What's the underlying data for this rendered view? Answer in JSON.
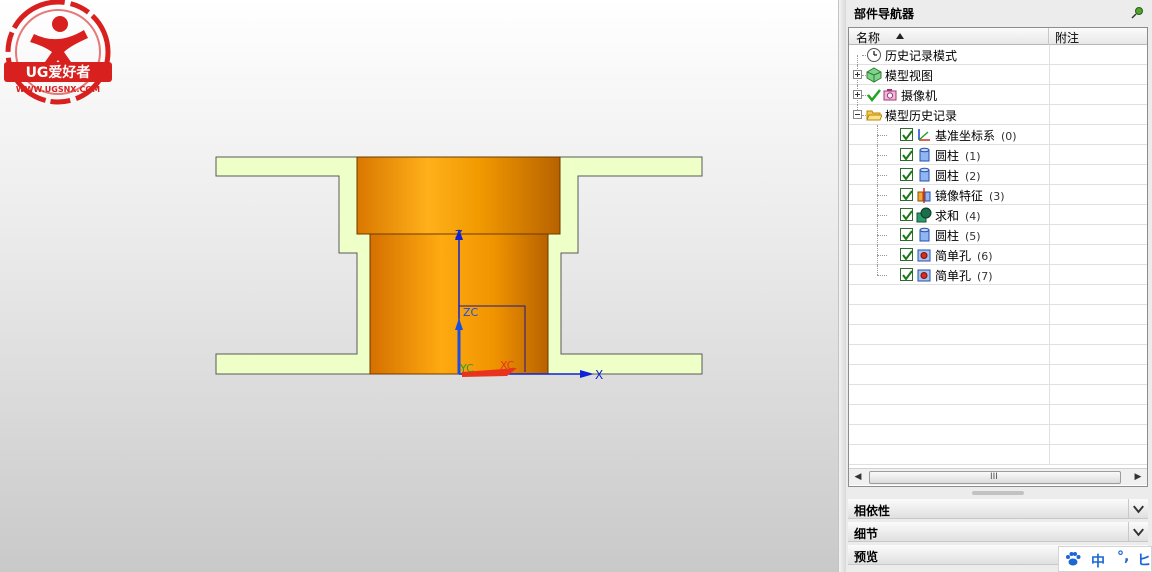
{
  "viewport": {
    "axes": {
      "x": "X",
      "z": "Z",
      "xc": "XC",
      "yc": "YC",
      "zc": "ZC"
    },
    "colors": {
      "part": "#f29a00",
      "fixture": "#eeffc7",
      "axis": "#0f22d6",
      "csys_box": "#1a1a8c"
    }
  },
  "watermark": {
    "brand": "UG爱好者",
    "site": "WWW.UGSNX.COM"
  },
  "navigator": {
    "title": "部件导航器",
    "columns": {
      "name": "名称",
      "note": "附注"
    },
    "rows": [
      {
        "label": "历史记录模式",
        "icon": "clock-icon",
        "level": 0,
        "expander": "none",
        "checked": false,
        "count": ""
      },
      {
        "label": "模型视图",
        "icon": "model-views-icon",
        "level": 0,
        "expander": "plus",
        "checked": false,
        "count": ""
      },
      {
        "label": "摄像机",
        "icon": "camera-icon",
        "level": 0,
        "expander": "plus",
        "checked": true,
        "count": ""
      },
      {
        "label": "模型历史记录",
        "icon": "folder-open-icon",
        "level": 0,
        "expander": "minus",
        "checked": false,
        "count": ""
      },
      {
        "label": "基准坐标系",
        "icon": "datum-csys-icon",
        "level": 1,
        "expander": "none",
        "checked": true,
        "count": "(0)"
      },
      {
        "label": "圆柱",
        "icon": "cylinder-icon",
        "level": 1,
        "expander": "none",
        "checked": true,
        "count": "(1)"
      },
      {
        "label": "圆柱",
        "icon": "cylinder-icon",
        "level": 1,
        "expander": "none",
        "checked": true,
        "count": "(2)"
      },
      {
        "label": "镜像特征",
        "icon": "mirror-feature-icon",
        "level": 1,
        "expander": "none",
        "checked": true,
        "count": "(3)"
      },
      {
        "label": "求和",
        "icon": "unite-icon",
        "level": 1,
        "expander": "none",
        "checked": true,
        "count": "(4)"
      },
      {
        "label": "圆柱",
        "icon": "cylinder-icon",
        "level": 1,
        "expander": "none",
        "checked": true,
        "count": "(5)"
      },
      {
        "label": "简单孔",
        "icon": "hole-icon",
        "level": 1,
        "expander": "none",
        "checked": true,
        "count": "(6)"
      },
      {
        "label": "简单孔",
        "icon": "hole-icon",
        "level": 1,
        "expander": "none",
        "checked": true,
        "count": "(7)"
      }
    ],
    "scroll_grip": "III",
    "sections": [
      {
        "label": "相依性"
      },
      {
        "label": "细节"
      },
      {
        "label": "预览"
      }
    ]
  },
  "ime": {
    "mode": "中",
    "punct": "°,",
    "more": "ヒ"
  }
}
